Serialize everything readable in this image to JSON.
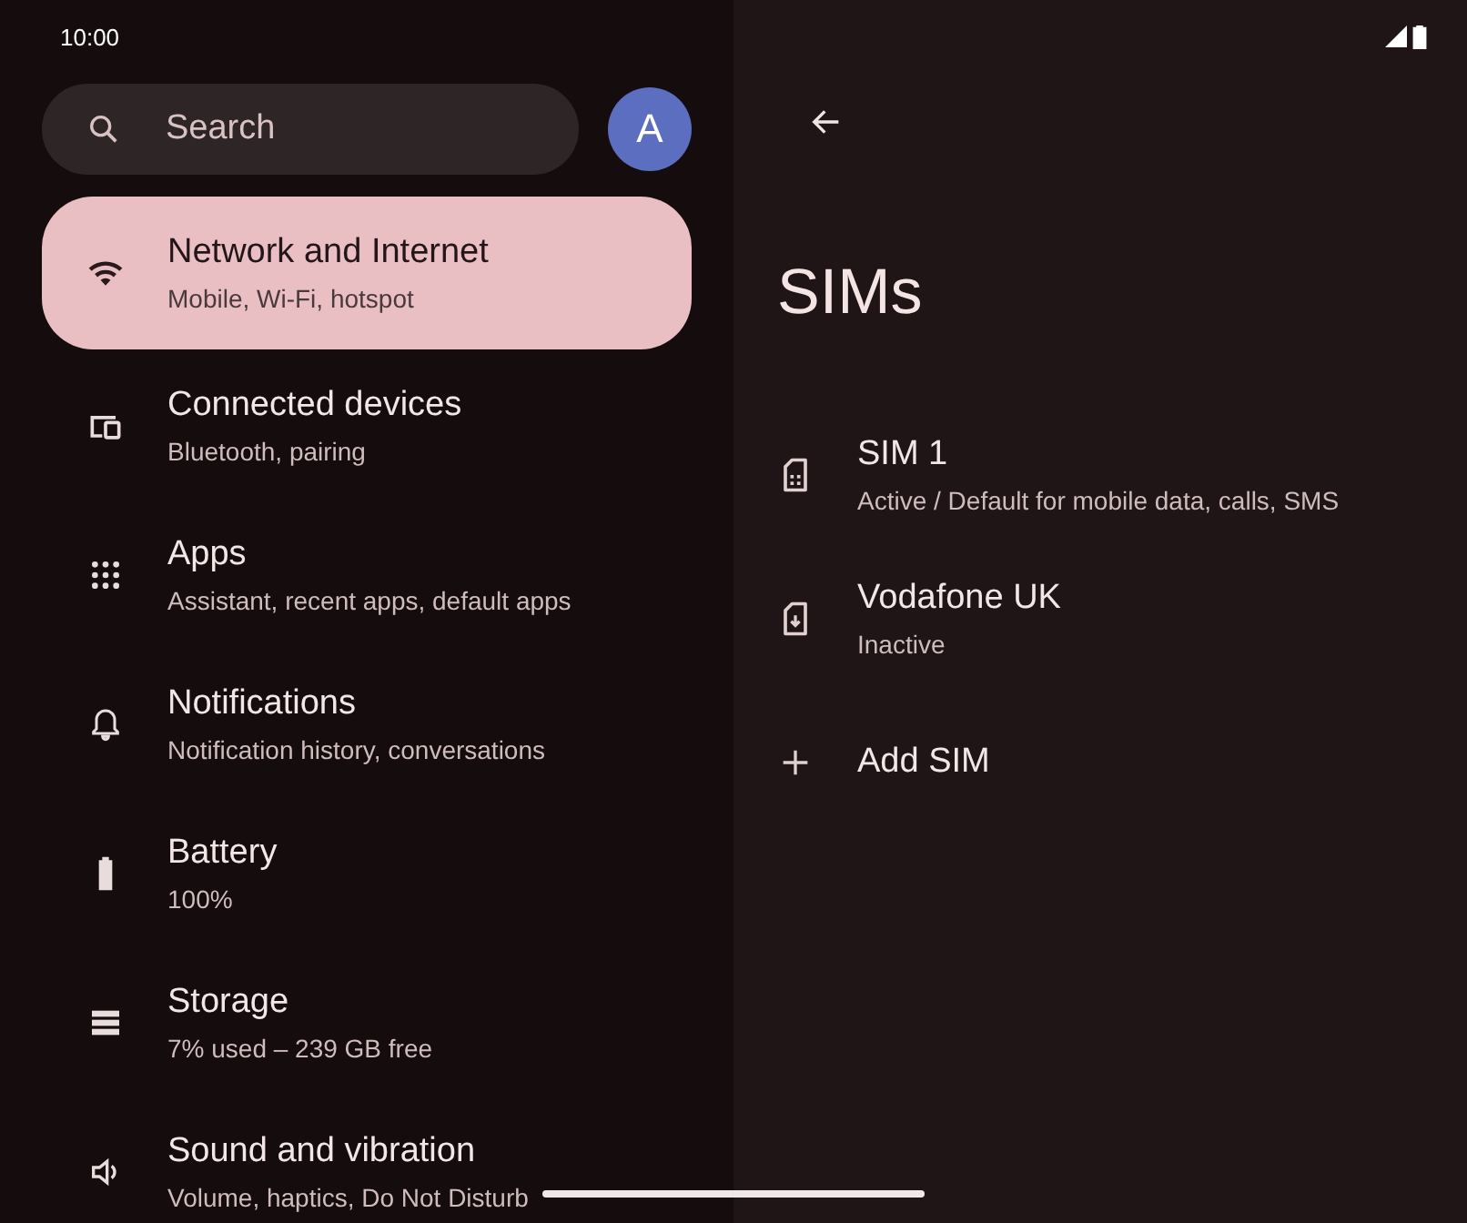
{
  "status_bar": {
    "time": "10:00"
  },
  "search": {
    "placeholder": "Search"
  },
  "avatar": {
    "letter": "A"
  },
  "settings": [
    {
      "kind": "wifi",
      "title": "Network and Internet",
      "subtitle": "Mobile, Wi-Fi, hotspot",
      "selected": true
    },
    {
      "kind": "devices",
      "title": "Connected devices",
      "subtitle": "Bluetooth, pairing",
      "selected": false
    },
    {
      "kind": "apps",
      "title": "Apps",
      "subtitle": "Assistant, recent apps, default apps",
      "selected": false
    },
    {
      "kind": "bell",
      "title": "Notifications",
      "subtitle": "Notification history, conversations",
      "selected": false
    },
    {
      "kind": "battery",
      "title": "Battery",
      "subtitle": "100%",
      "selected": false
    },
    {
      "kind": "storage",
      "title": "Storage",
      "subtitle": "7% used – 239 GB free",
      "selected": false
    },
    {
      "kind": "sound",
      "title": "Sound and vibration",
      "subtitle": "Volume, haptics, Do Not Disturb",
      "selected": false
    }
  ],
  "detail": {
    "title": "SIMs",
    "items": [
      {
        "kind": "sim",
        "title": "SIM 1",
        "subtitle": "Active / Default for mobile data, calls, SMS"
      },
      {
        "kind": "esim",
        "title": "Vodafone UK",
        "subtitle": "Inactive"
      },
      {
        "kind": "plus",
        "title": "Add SIM"
      }
    ]
  }
}
